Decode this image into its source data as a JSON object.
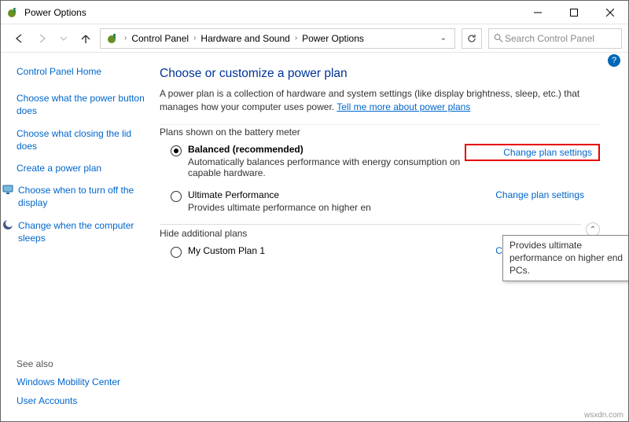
{
  "title": "Power Options",
  "breadcrumb": [
    "Control Panel",
    "Hardware and Sound",
    "Power Options"
  ],
  "search": {
    "placeholder": "Search Control Panel"
  },
  "sidebar": {
    "home": "Control Panel Home",
    "items": [
      "Choose what the power button does",
      "Choose what closing the lid does",
      "Create a power plan",
      "Choose when to turn off the display",
      "Change when the computer sleeps"
    ],
    "see_also": "See also",
    "see_also_items": [
      "Windows Mobility Center",
      "User Accounts"
    ]
  },
  "main": {
    "heading": "Choose or customize a power plan",
    "description": "A power plan is a collection of hardware and system settings (like display brightness, sleep, etc.) that manages how your computer uses power. ",
    "more_link": "Tell me more about power plans",
    "section_shown": "Plans shown on the battery meter",
    "section_hidden": "Hide additional plans",
    "change_link": "Change plan settings",
    "plans": [
      {
        "name": "Balanced (recommended)",
        "sub": "Automatically balances performance with energy consumption on capable hardware.",
        "checked": true,
        "bold": true
      },
      {
        "name": "Ultimate Performance",
        "sub": "Provides ultimate performance on higher en",
        "checked": false,
        "bold": false
      }
    ],
    "hidden_plans": [
      {
        "name": "My Custom Plan 1",
        "checked": false
      }
    ],
    "tooltip": "Provides ultimate performance on higher end PCs."
  },
  "watermark": "wsxdn.com"
}
